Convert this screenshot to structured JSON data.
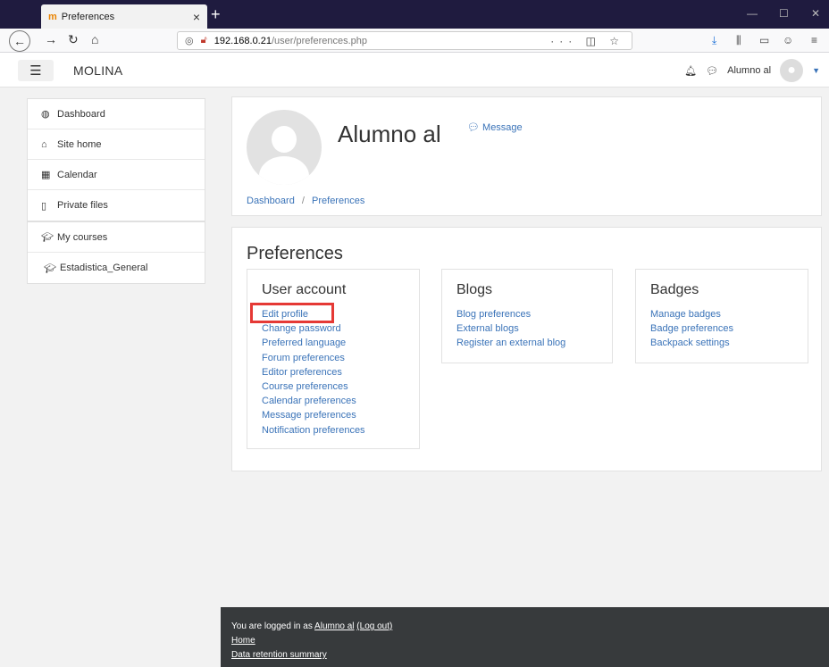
{
  "browser": {
    "tab_favicon": "m",
    "tab_title": "Preferences",
    "tab_close": "×",
    "new_tab": "+",
    "url_host": "192.168.0.21",
    "url_path": "/user/preferences.php",
    "url_more": "···"
  },
  "header": {
    "site_name": "MOLINA",
    "user_name": "Alumno al"
  },
  "sidebar": {
    "items": [
      {
        "label": "Dashboard",
        "icon": "dashboard-icon"
      },
      {
        "label": "Site home",
        "icon": "home-icon"
      },
      {
        "label": "Calendar",
        "icon": "calendar-icon"
      },
      {
        "label": "Private files",
        "icon": "file-icon"
      }
    ],
    "courses_label": "My courses",
    "course_item": "Estadistica_General"
  },
  "profile": {
    "name": "Alumno al",
    "message_label": "Message",
    "breadcrumb": [
      "Dashboard",
      "Preferences"
    ],
    "breadcrumb_sep": "/"
  },
  "preferences": {
    "title": "Preferences",
    "user_account": {
      "heading": "User account",
      "links": [
        "Edit profile",
        "Change password",
        "Preferred language",
        "Forum preferences",
        "Editor preferences",
        "Course preferences",
        "Calendar preferences",
        "Message preferences",
        "Notification preferences"
      ]
    },
    "blogs": {
      "heading": "Blogs",
      "links": [
        "Blog preferences",
        "External blogs",
        "Register an external blog"
      ]
    },
    "badges": {
      "heading": "Badges",
      "links": [
        "Manage badges",
        "Badge preferences",
        "Backpack settings"
      ]
    }
  },
  "footer": {
    "logged_prefix": "You are logged in as ",
    "logged_user": "Alumno al",
    "logout": "(Log out)",
    "home": "Home",
    "data_retention": "Data retention summary"
  },
  "colors": {
    "link": "#3a73b8",
    "highlight": "#e53935",
    "footer": "#373a3c"
  }
}
